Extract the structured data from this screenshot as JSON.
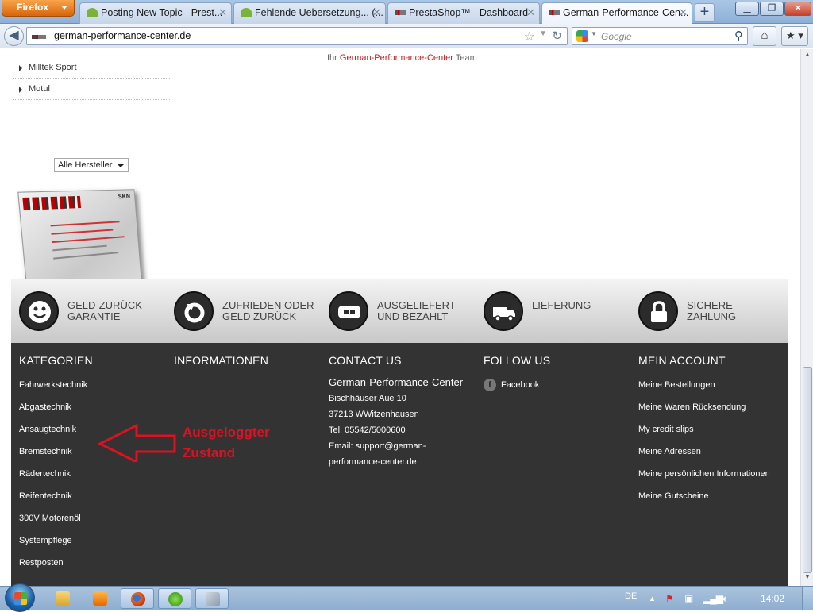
{
  "browser": {
    "menu_button": "Firefox",
    "tabs": [
      {
        "title": "Posting New Topic - Prest...",
        "active": false,
        "favicon": "prestashop-icon"
      },
      {
        "title": "Fehlende Uebersetzung... (...",
        "active": false,
        "favicon": "prestashop-icon"
      },
      {
        "title": "PrestaShop™ - Dashboard",
        "active": false,
        "favicon": "gpc-icon"
      },
      {
        "title": "German-Performance-Cen...",
        "active": true,
        "favicon": "gpc-icon"
      }
    ],
    "new_tab": "+",
    "url": "german-performance-center.de",
    "search_placeholder": "Google"
  },
  "sidebar": {
    "manufacturers": [
      "Milltek Sport",
      "Motul"
    ],
    "manufacturer_select": "Alle Hersteller",
    "banner_logo": "SKN"
  },
  "signature": {
    "prefix": "Ihr",
    "company": "German-Performance-Center",
    "suffix": "Team"
  },
  "guarantees": [
    {
      "line1": "GELD-ZURÜCK-",
      "line2": "GARANTIE",
      "icon": "smiley-icon"
    },
    {
      "line1": "ZUFRIEDEN ODER",
      "line2": "GELD ZURÜCK",
      "icon": "refresh-icon"
    },
    {
      "line1": "AUSGELIEFERT",
      "line2": "UND BEZAHLT",
      "icon": "card-icon"
    },
    {
      "line1": "LIEFERUNG",
      "line2": "",
      "icon": "truck-icon"
    },
    {
      "line1": "SICHERE",
      "line2": "ZAHLUNG",
      "icon": "lock-icon"
    }
  ],
  "footer": {
    "categories": {
      "heading": "Kategorien",
      "items": [
        "Fahrwerkstechnik",
        "Abgastechnik",
        "Ansaugtechnik",
        "Bremstechnik",
        "Rädertechnik",
        "Reifentechnik",
        "300V Motorenöl",
        "Systempflege",
        "Restposten"
      ]
    },
    "information": {
      "heading": "Informationen"
    },
    "contact": {
      "heading": "Contact us",
      "company": "German-Performance-Center",
      "street": "Bischhäuser Aue 10",
      "city": "37213 WWitzenhausen",
      "phone": "Tel: 05542/5000600",
      "email_line1": "Email: support@german-",
      "email_line2": "performance-center.de"
    },
    "follow": {
      "heading": "Follow us",
      "facebook": "Facebook"
    },
    "account": {
      "heading": "Mein Account",
      "items": [
        "Meine Bestellungen",
        "Meine Waren Rücksendung",
        "My credit slips",
        "Meine Adressen",
        "Meine persönlichen Informationen",
        "Meine Gutscheine"
      ]
    }
  },
  "annotation": {
    "line1": "Ausgeloggter",
    "line2": "Zustand"
  },
  "taskbar": {
    "language": "DE",
    "clock": "14:02"
  },
  "colors": {
    "brand_red": "#b22222",
    "footer_bg": "#333333",
    "annotation_red": "#dd1122"
  }
}
